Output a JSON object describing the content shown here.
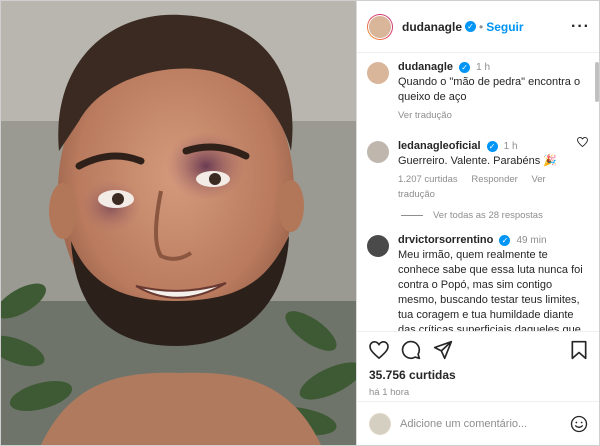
{
  "post": {
    "username": "dudanagle",
    "follow_label": "Seguir",
    "separator": "•",
    "more_label": "···"
  },
  "caption": {
    "username": "dudanagle",
    "time": "1 h",
    "text": "Quando o \"mão de pedra\" encontra o queixo de aço",
    "translate": "Ver tradução"
  },
  "comments": [
    {
      "username": "ledanagleoficial",
      "time": "1 h",
      "text": "Guerreiro. Valente. Parabéns 🎉",
      "likes": "1.207 curtidas",
      "reply": "Responder",
      "translate": "Ver tradução"
    },
    {
      "username": "drvictorsorrentino",
      "time": "49 min",
      "text": "Meu irmão, quem realmente te conhece sabe que essa luta nunca foi contra o Popó, mas sim contigo mesmo, buscando testar teus limites, tua coragem e tua humildade diante das críticas superficiais daqueles que não entendem que lutar é muito mais do que só vencer ou perder..."
    }
  ],
  "view_replies": "Ver todas as 28 respostas",
  "likes_count": "35.756 curtidas",
  "time_ago": "há 1 hora",
  "add_comment_placeholder": "Adicione um comentário...",
  "colors": {
    "link": "#0095f6",
    "verified": "#0095f6",
    "muted": "#8e8e8e",
    "text": "#262626"
  },
  "icons": [
    "heart-icon",
    "comment-icon",
    "share-icon",
    "bookmark-icon",
    "more-icon",
    "emoji-icon",
    "verified-badge-icon"
  ]
}
